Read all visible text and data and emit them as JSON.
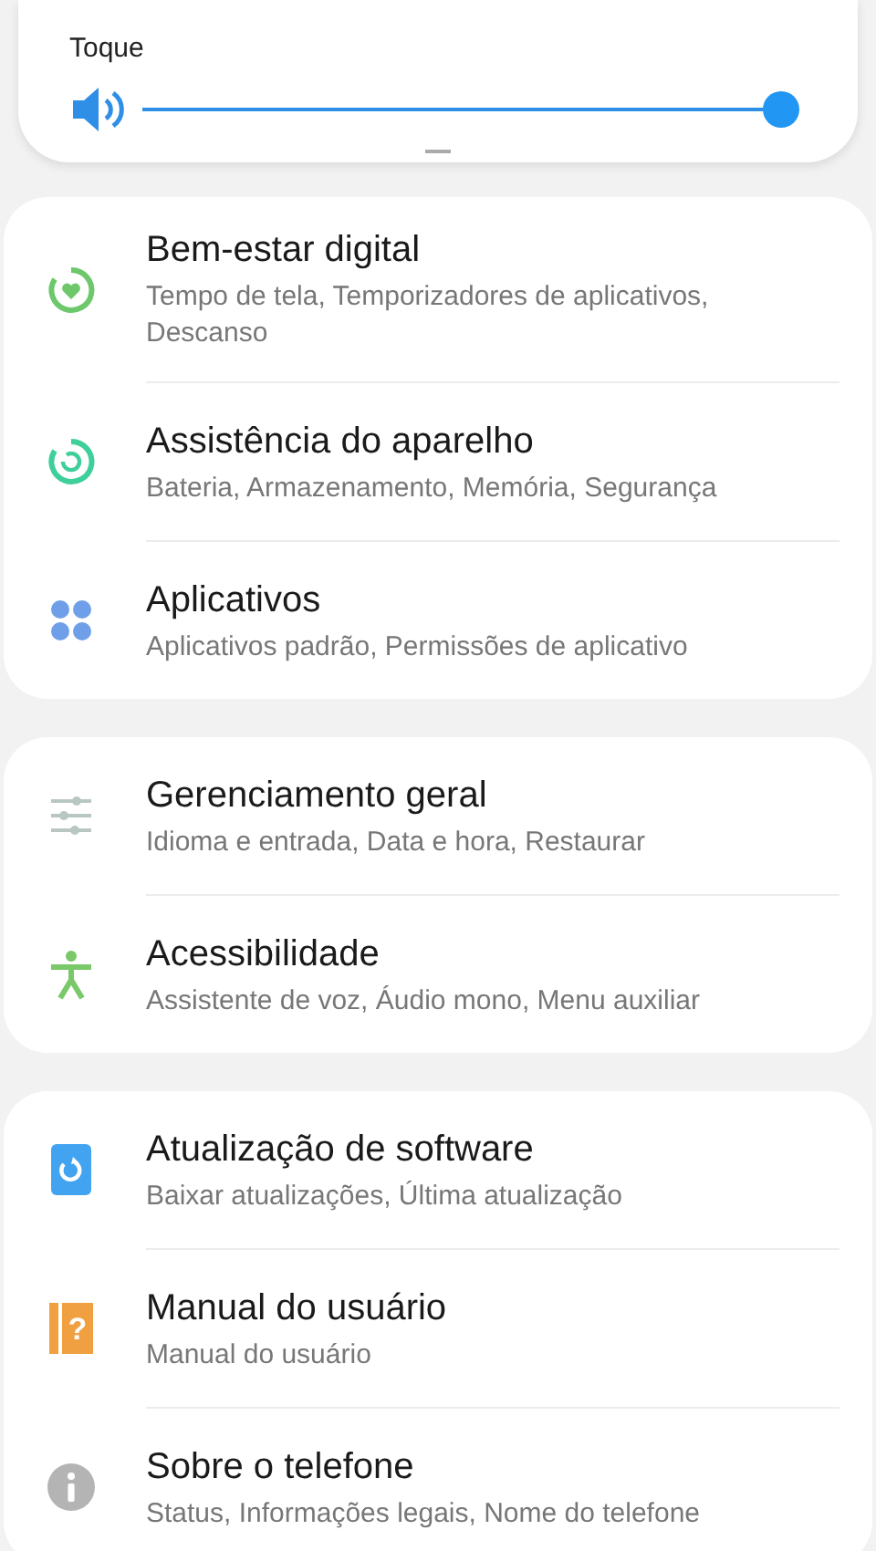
{
  "volume_panel": {
    "label": "Toque",
    "level": 1
  },
  "groups": [
    {
      "items": [
        {
          "title": "Bem-estar digital",
          "subtitle": "Tempo de tela, Temporizadores de aplicativos, Descanso"
        },
        {
          "title": "Assistência do aparelho",
          "subtitle": "Bateria, Armazenamento, Memória, Segurança"
        },
        {
          "title": "Aplicativos",
          "subtitle": "Aplicativos padrão, Permissões de aplicativo"
        }
      ]
    },
    {
      "items": [
        {
          "title": "Gerenciamento geral",
          "subtitle": "Idioma e entrada, Data e hora, Restaurar"
        },
        {
          "title": "Acessibilidade",
          "subtitle": "Assistente de voz, Áudio mono, Menu auxiliar"
        }
      ]
    },
    {
      "items": [
        {
          "title": "Atualização de software",
          "subtitle": "Baixar atualizações, Última atualização"
        },
        {
          "icon_text": "?",
          "title": "Manual do usuário",
          "subtitle": "Manual do usuário"
        },
        {
          "title": "Sobre o telefone",
          "subtitle": "Status, Informações legais, Nome do telefone"
        }
      ]
    }
  ]
}
